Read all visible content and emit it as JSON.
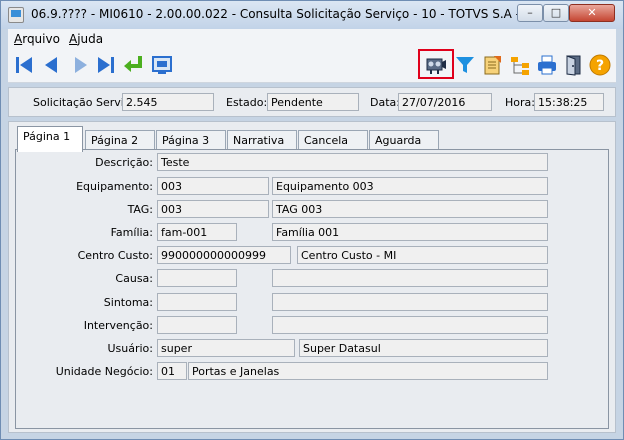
{
  "window": {
    "title": "06.9.???? - MI0610 - 2.00.00.022 - Consulta Solicitação Serviço - 10 - TOTVS S.A - Ambiente C...",
    "minimize": "–",
    "maximize": "□",
    "close": "✕"
  },
  "menu": {
    "arquivo_first": "A",
    "arquivo_rest": "rquivo",
    "ajuda_first": "A",
    "ajuda_rest": "juda"
  },
  "toolbar": {
    "icons": [
      "first-icon",
      "previous-icon",
      "next-icon",
      "last-icon",
      "return-icon",
      "screen-icon",
      "filter-camera-icon",
      "filter-icon",
      "report-icon",
      "tree-icon",
      "print-icon",
      "exit-icon",
      "help-icon"
    ],
    "colors": {
      "accent_blue": "#2b6fcf",
      "highlight_red": "#e0001b",
      "green": "#4caf1f",
      "orange": "#f5a300"
    }
  },
  "header": {
    "solicitacao_label": "Solicitação Serviço:",
    "solicitacao_value": "2.545",
    "estado_label": "Estado:",
    "estado_value": "Pendente",
    "data_label": "Data:",
    "data_value": "27/07/2016",
    "hora_label": "Hora:",
    "hora_value": "15:38:25"
  },
  "tabs": [
    "Página 1",
    "Página 2",
    "Página 3",
    "Narrativa",
    "Cancela",
    "Aguarda"
  ],
  "form": {
    "descricao_label": "Descrição:",
    "descricao_value": "Teste",
    "equipamento_label": "Equipamento:",
    "equipamento_code": "003",
    "equipamento_desc": "Equipamento 003",
    "tag_label": "TAG:",
    "tag_code": "003",
    "tag_desc": "TAG 003",
    "familia_label": "Família:",
    "familia_code": "fam-001",
    "familia_desc": "Família 001",
    "centro_custo_label": "Centro Custo:",
    "centro_custo_code": "990000000000999",
    "centro_custo_desc": "Centro Custo - MI",
    "causa_label": "Causa:",
    "causa_code": "",
    "causa_desc": "",
    "sintoma_label": "Sintoma:",
    "sintoma_code": "",
    "sintoma_desc": "",
    "intervencao_label": "Intervenção:",
    "intervencao_code": "",
    "intervencao_desc": "",
    "usuario_label": "Usuário:",
    "usuario_code": "super",
    "usuario_desc": "Super Datasul",
    "unidade_label": "Unidade Negócio:",
    "unidade_code": "01",
    "unidade_desc": "Portas e Janelas"
  }
}
